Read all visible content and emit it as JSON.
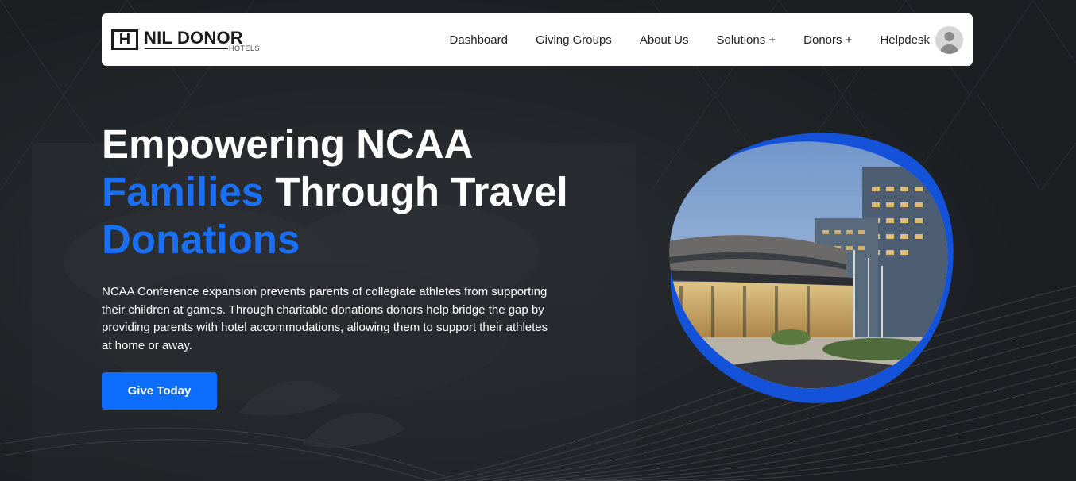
{
  "brand": {
    "icon_letter": "H",
    "name": "NIL DONOR",
    "subtitle": "HOTELS"
  },
  "nav": {
    "items": [
      {
        "label": "Dashboard"
      },
      {
        "label": "Giving Groups"
      },
      {
        "label": "About Us"
      },
      {
        "label": "Solutions +"
      },
      {
        "label": "Donors +"
      },
      {
        "label": "Helpdesk"
      }
    ]
  },
  "hero": {
    "title_part1": "Empowering NCAA",
    "title_part2_accent": "Families",
    "title_part3": " Through Travel",
    "title_part4_accent": "Donations",
    "description": "NCAA Conference expansion prevents parents of collegiate athletes from supporting their children at games. Through charitable donations donors help bridge the gap by providing parents with hotel accommodations, allowing them to support their athletes at home or away.",
    "cta_label": "Give Today"
  },
  "colors": {
    "accent": "#1b6ff5",
    "button": "#0d6efd",
    "background": "#1f2226",
    "navbar": "#ffffff"
  },
  "icons": {
    "logo": "hotel-logo-icon",
    "avatar": "user-avatar-icon"
  }
}
